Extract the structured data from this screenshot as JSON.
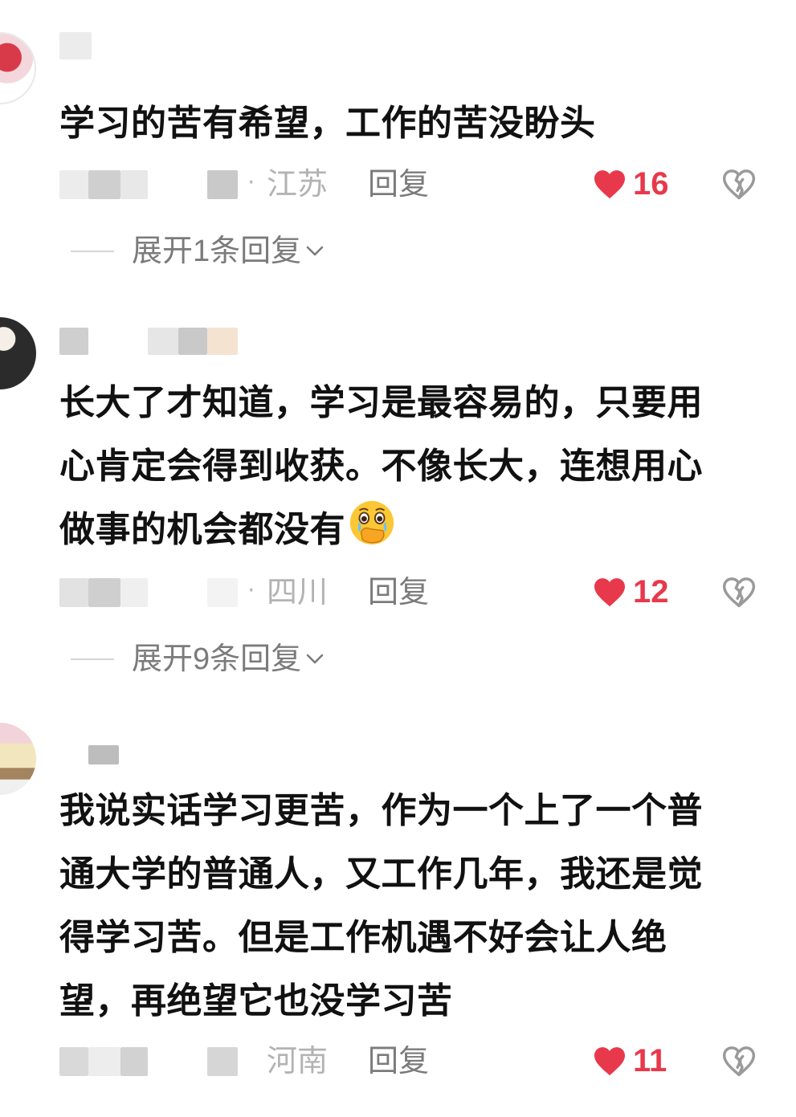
{
  "comments": [
    {
      "text": "学习的苦有希望，工作的苦没盼头",
      "location": "江苏",
      "reply_label": "回复",
      "likes": "16",
      "expand_label": "展开1条回复"
    },
    {
      "text": "长大了才知道，学习是最容易的，只要用\n心肯定会得到收获。不像长大，连想用心\n做事的机会都没有",
      "location": "四川",
      "reply_label": "回复",
      "likes": "12",
      "expand_label": "展开9条回复"
    },
    {
      "text": "我说实话学习更苦，作为一个上了一个普\n通大学的普通人，又工作几年，我还是觉\n得学习苦。但是工作机遇不好会让人绝\n望，再绝望它也没学习苦",
      "location": "河南",
      "reply_label": "回复",
      "likes": "11"
    }
  ],
  "colors": {
    "like_red": "#e8394c",
    "secondary_gray": "#7b7b7b",
    "location_gray": "#b3b3b3"
  },
  "icons": {
    "like": "heart-filled-icon",
    "dislike": "broken-heart-icon",
    "expand": "chevron-down-icon",
    "emoji": "crying-hand-over-mouth-emoji"
  }
}
